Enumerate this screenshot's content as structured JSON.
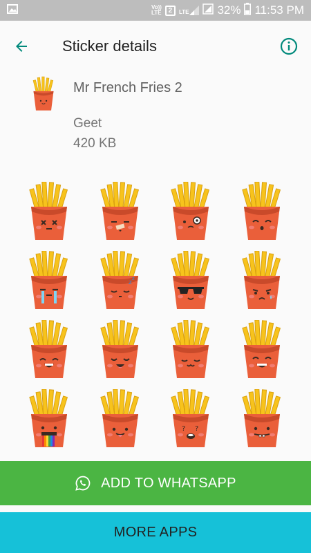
{
  "status_bar": {
    "volte_label": "Vo))",
    "lte_label": "LTE",
    "sim_label": "2",
    "lte2_label": "LTE",
    "battery": "32%",
    "time": "11:53 PM"
  },
  "app_bar": {
    "title": "Sticker details"
  },
  "pack": {
    "name": "Mr French Fries 2",
    "author": "Geet",
    "size": "420 KB"
  },
  "stickers": [
    {
      "face": "dizzy"
    },
    {
      "face": "bandage"
    },
    {
      "face": "monocle"
    },
    {
      "face": "happy-closed"
    },
    {
      "face": "crying"
    },
    {
      "face": "sleepy"
    },
    {
      "face": "sunglasses"
    },
    {
      "face": "sad-tear"
    },
    {
      "face": "grin"
    },
    {
      "face": "laugh"
    },
    {
      "face": "content"
    },
    {
      "face": "smile-wide"
    },
    {
      "face": "rainbow"
    },
    {
      "face": "tongue"
    },
    {
      "face": "confused"
    },
    {
      "face": "teeth"
    }
  ],
  "buttons": {
    "add_label": "ADD TO WHATSAPP",
    "more_label": "MORE APPS"
  },
  "colors": {
    "accent": "#00897b",
    "add_button": "#4bb543",
    "more_button": "#16c1d8",
    "fries_box": "#ea5f3a",
    "fries": "#f7c31c"
  }
}
